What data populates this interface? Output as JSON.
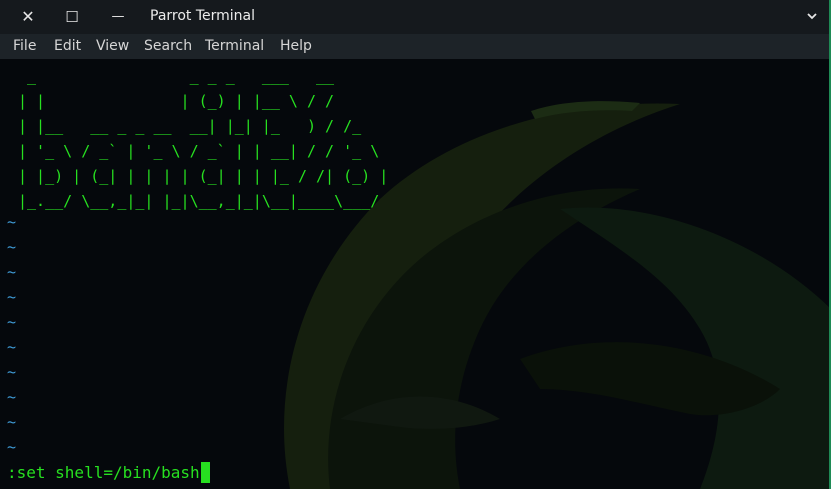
{
  "window": {
    "title": "Parrot Terminal",
    "close_glyph": "✕",
    "maximize_glyph": "☐",
    "minimize_glyph": "—"
  },
  "menu": {
    "file": "File",
    "edit": "Edit",
    "view": "View",
    "search": "Search",
    "terminal": "Terminal",
    "help": "Help"
  },
  "terminal": {
    "banner_lines": [
      " _                 _ _ _   ___   __",
      "| |               | (_) | |__ \\ / /",
      "| |__   __ _ _ __  __| |_| |_   ) / /_",
      "| '_ \\ / _` | '_ \\ / _` | | __| / / '_ \\",
      "| |_) | (_| | | | | (_| | | |_ / /| (_) |",
      "|_.__/ \\__,_|_| |_|\\__,_|_|\\__|____\\___/"
    ],
    "tilde": "~",
    "tilde_count": 10,
    "command": ":set shell=/bin/bash"
  },
  "colors": {
    "prompt_green": "#27e020",
    "tilde_blue": "#3f9bd6",
    "background": "#05080c"
  },
  "icons": {
    "close": "close-icon",
    "maximize": "maximize-icon",
    "minimize": "minimize-icon",
    "dropdown": "chevron-down-icon"
  }
}
